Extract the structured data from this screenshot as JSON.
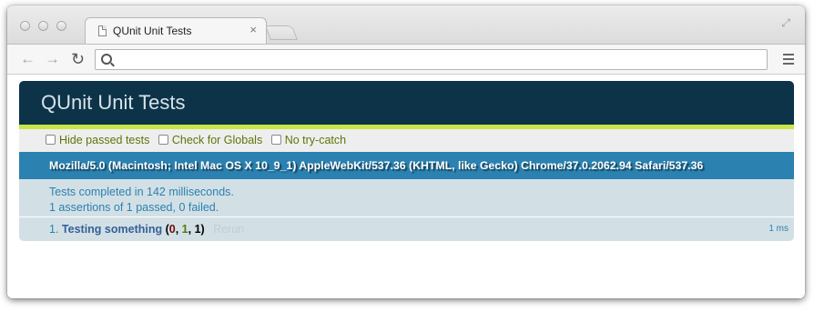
{
  "browser": {
    "tab_title": "QUnit Unit Tests",
    "tab_close": "×",
    "address_value": ""
  },
  "qunit": {
    "header": "QUnit Unit Tests",
    "toolbar": {
      "options": [
        "Hide passed tests",
        "Check for Globals",
        "No try-catch"
      ]
    },
    "useragent": "Mozilla/5.0 (Macintosh; Intel Mac OS X 10_9_1) AppleWebKit/537.36 (KHTML, like Gecko) Chrome/37.0.2062.94 Safari/537.36",
    "result_line1": "Tests completed in 142 milliseconds.",
    "result_line2": "1 assertions of 1 passed, 0 failed.",
    "tests": [
      {
        "number": "1.",
        "name": "Testing something",
        "failed": "0",
        "passed": "1",
        "total": "1",
        "rerun": "Rerun",
        "runtime": "1 ms"
      }
    ]
  },
  "colors": {
    "header_bg": "#0d3349",
    "header_accent": "#c6e746",
    "useragent_bg": "#2b81af",
    "result_bg": "#d2e0e6"
  },
  "icons": {
    "back": "back-arrow-icon",
    "forward": "forward-arrow-icon",
    "reload": "reload-icon",
    "search": "search-icon",
    "menu": "menu-icon",
    "fullscreen": "fullscreen-icon",
    "page": "page-icon"
  }
}
